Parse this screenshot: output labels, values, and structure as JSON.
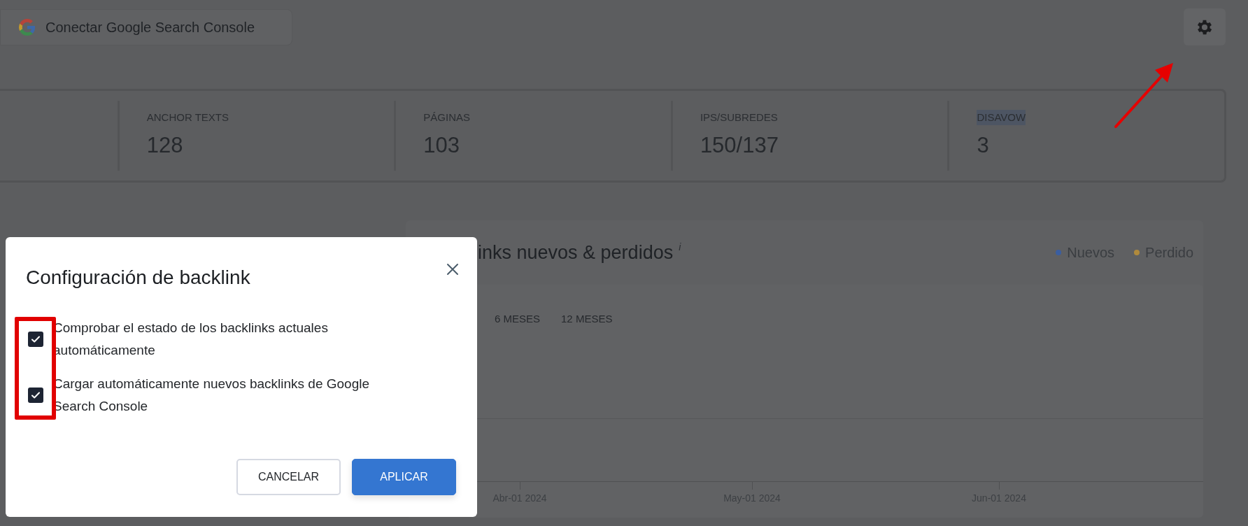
{
  "header": {
    "connect_button": "Conectar Google Search Console"
  },
  "stats": [
    {
      "label": "ANCHOR TEXTS",
      "value": "128",
      "text_selected": false
    },
    {
      "label": "PÁGINAS",
      "value": "103",
      "text_selected": false
    },
    {
      "label": "IPS/SUBREDES",
      "value": "150/137",
      "text_selected": false
    },
    {
      "label": "DISAVOW",
      "value": "3",
      "text_selected": true
    }
  ],
  "chart_card": {
    "title": "inks nuevos & perdidos",
    "info_mark": "i",
    "legend": [
      {
        "label": "Nuevos",
        "color": "#3a5ea0"
      },
      {
        "label": "Perdido",
        "color": "#b08a3c"
      }
    ],
    "periods": [
      "6 MESES",
      "12 MESES"
    ],
    "x_axis_labels": [
      "Abr-01 2024",
      "May-01 2024",
      "Jun-01 2024"
    ]
  },
  "dialog": {
    "title": "Configuración de backlink",
    "options": [
      {
        "label": "Comprobar el estado de los backlinks actuales automáticamente",
        "checked": true
      },
      {
        "label": "Cargar automáticamente nuevos backlinks de Google Search Console",
        "checked": true
      }
    ],
    "buttons": [
      {
        "label": "CANCELAR",
        "kind": "secondary"
      },
      {
        "label": "APLICAR",
        "kind": "primary"
      }
    ]
  }
}
